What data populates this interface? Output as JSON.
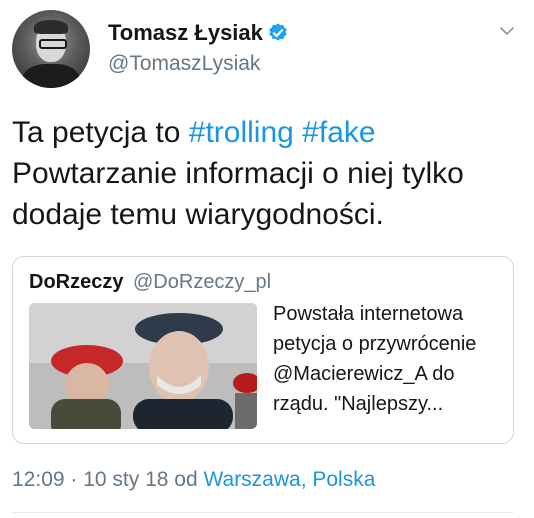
{
  "tweet": {
    "author": {
      "display_name": "Tomasz Łysiak",
      "handle": "@TomaszLysiak",
      "verified": true
    },
    "text_plain_1": "Ta petycja to ",
    "hashtag_1": "#trolling",
    "text_plain_2": " ",
    "hashtag_2": "#fake",
    "text_plain_3": " Powtarzanie informacji o niej tylko dodaje temu wiarygodności.",
    "quoted": {
      "display_name": "DoRzeczy",
      "handle": "@DoRzeczy_pl",
      "text": "Powstała internetowa\npetycja o przywrócenie\n@Macierewicz_A do\nrządu. \"Najlepszy..."
    },
    "timestamp": "12:09 · 10 sty 18",
    "source_prefix": " od ",
    "location": "Warszawa, Polska"
  },
  "colors": {
    "link": "#1b95e0",
    "secondary_text": "#657786",
    "border": "#ccd6dd"
  },
  "icons": {
    "verified": "verified-badge-icon",
    "menu": "chevron-down-icon"
  }
}
